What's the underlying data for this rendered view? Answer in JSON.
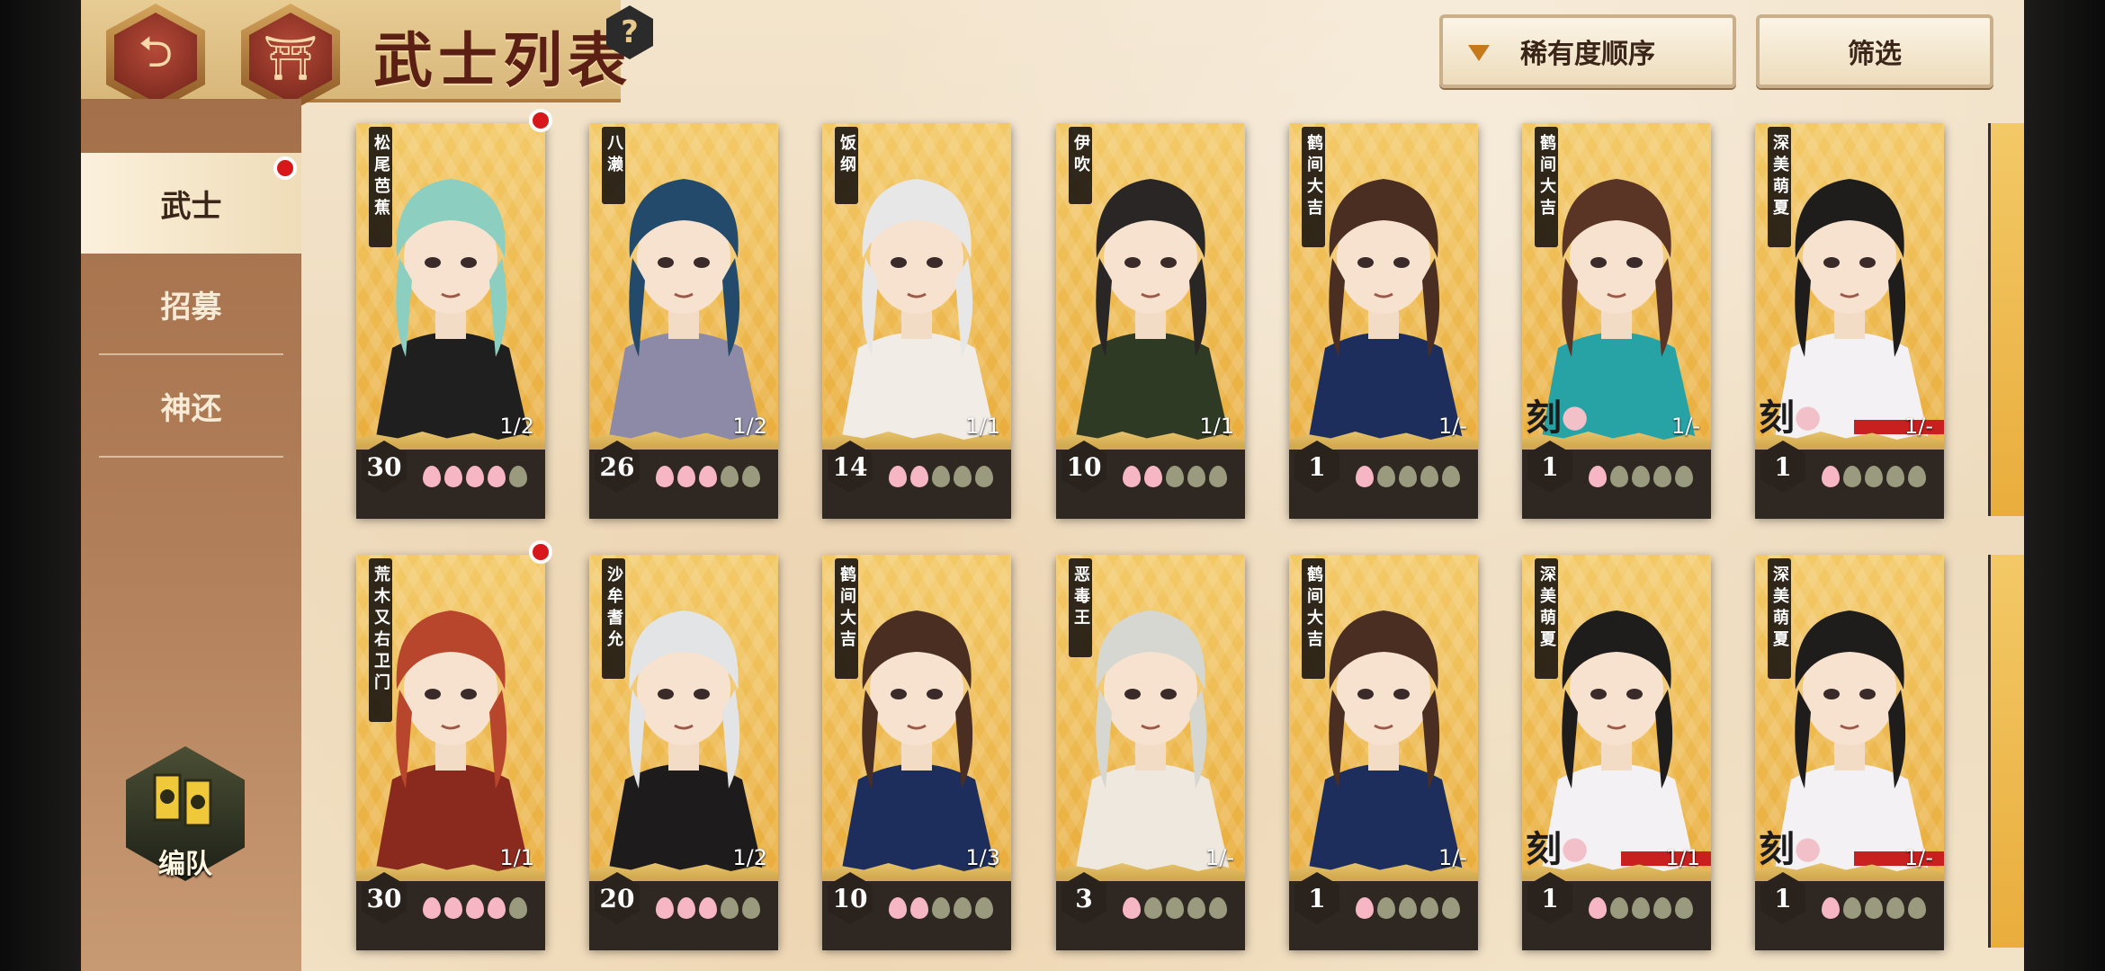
{
  "header": {
    "title": "武士列表",
    "back_icon": "⮌",
    "home_icon": "⛩",
    "help_label": "?",
    "sort_label": "稀有度顺序",
    "filter_label": "筛选"
  },
  "sidebar": {
    "items": [
      {
        "label": "武士",
        "active": true,
        "badge": true
      },
      {
        "label": "招募",
        "active": false,
        "badge": false
      },
      {
        "label": "神还",
        "active": false,
        "badge": false
      }
    ],
    "team_label": "编队"
  },
  "cards": [
    {
      "name": "松尾芭蕉",
      "level": "30",
      "bond": "1/2",
      "petals": [
        1,
        1,
        1,
        1,
        0
      ],
      "badge": true,
      "koku": false,
      "red": false,
      "theme": "teal-hair"
    },
    {
      "name": "八濑",
      "level": "26",
      "bond": "1/2",
      "petals": [
        1,
        1,
        1,
        0,
        0
      ],
      "badge": false,
      "koku": false,
      "red": false,
      "theme": "blue-hair"
    },
    {
      "name": "饭纲",
      "level": "14",
      "bond": "1/1",
      "petals": [
        1,
        1,
        0,
        0,
        0
      ],
      "badge": false,
      "koku": false,
      "red": false,
      "theme": "white-hair"
    },
    {
      "name": "伊吹",
      "level": "10",
      "bond": "1/1",
      "petals": [
        1,
        1,
        0,
        0,
        0
      ],
      "badge": false,
      "koku": false,
      "red": false,
      "theme": "black-hair"
    },
    {
      "name": "鹤间大吉",
      "level": "1",
      "bond": "1/-",
      "petals": [
        1,
        0,
        0,
        0,
        0
      ],
      "badge": false,
      "koku": false,
      "red": false,
      "theme": "brown-hair"
    },
    {
      "name": "鹤间大吉",
      "level": "1",
      "bond": "1/-",
      "petals": [
        1,
        0,
        0,
        0,
        0
      ],
      "badge": false,
      "koku": true,
      "red": false,
      "theme": "brown-hair-teal"
    },
    {
      "name": "深美萌夏",
      "level": "1",
      "bond": "1/-",
      "petals": [
        1,
        0,
        0,
        0,
        0
      ],
      "badge": false,
      "koku": true,
      "red": true,
      "theme": "shrine-maiden"
    },
    {
      "name": "荒木又右卫门",
      "level": "30",
      "bond": "1/1",
      "petals": [
        1,
        1,
        1,
        1,
        0
      ],
      "badge": true,
      "koku": false,
      "red": false,
      "theme": "red-hair"
    },
    {
      "name": "沙牟耆允",
      "level": "20",
      "bond": "1/2",
      "petals": [
        1,
        1,
        1,
        0,
        0
      ],
      "badge": false,
      "koku": false,
      "red": false,
      "theme": "white-short"
    },
    {
      "name": "鹤间大吉",
      "level": "10",
      "bond": "1/3",
      "petals": [
        1,
        1,
        0,
        0,
        0
      ],
      "badge": false,
      "koku": false,
      "red": false,
      "theme": "brown-hair"
    },
    {
      "name": "恶毒王",
      "level": "3",
      "bond": "1/-",
      "petals": [
        1,
        0,
        0,
        0,
        0
      ],
      "badge": false,
      "koku": false,
      "red": false,
      "theme": "oni"
    },
    {
      "name": "鹤间大吉",
      "level": "1",
      "bond": "1/-",
      "petals": [
        1,
        0,
        0,
        0,
        0
      ],
      "badge": false,
      "koku": false,
      "red": false,
      "theme": "brown-hair"
    },
    {
      "name": "深美萌夏",
      "level": "1",
      "bond": "1/1",
      "petals": [
        1,
        0,
        0,
        0,
        0
      ],
      "badge": false,
      "koku": true,
      "red": true,
      "theme": "shrine-maiden"
    },
    {
      "name": "深美萌夏",
      "level": "1",
      "bond": "1/-",
      "petals": [
        1,
        0,
        0,
        0,
        0
      ],
      "badge": false,
      "koku": true,
      "red": true,
      "theme": "shrine-maiden"
    }
  ],
  "koku_label": "刻",
  "colors": {
    "accent_red": "#d6181a",
    "gold": "#e9ad3c",
    "panel_brown": "#a4704b"
  }
}
